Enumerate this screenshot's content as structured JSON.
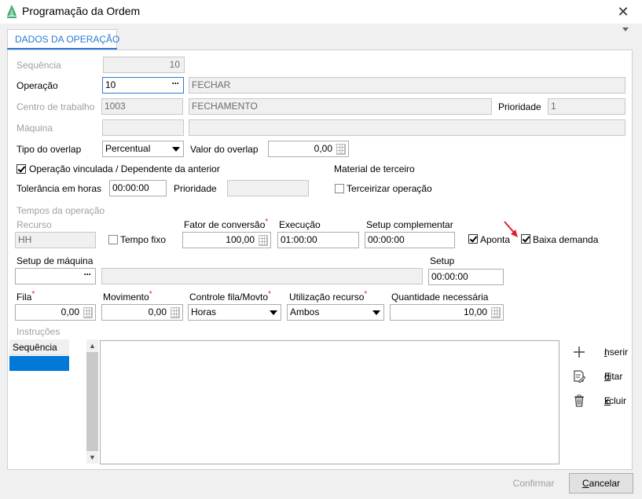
{
  "window": {
    "title": "Programação da Ordem",
    "close_glyph": "✕"
  },
  "tabs": [
    {
      "label": "DADOS DA OPERAÇÃO"
    }
  ],
  "form": {
    "sequencia": {
      "label": "Sequência",
      "value": "10"
    },
    "operacao": {
      "label": "Operação",
      "value": "10",
      "desc": "FECHAR",
      "lookup_glyph": "···"
    },
    "centro": {
      "label": "Centro de trabalho",
      "code": "1003",
      "desc": "FECHAMENTO"
    },
    "prioridade_top": {
      "label": "Prioridade",
      "value": "1"
    },
    "maquina": {
      "label": "Máquina",
      "code": "",
      "desc": ""
    },
    "tipo_overlap": {
      "label": "Tipo do overlap",
      "value": "Percentual"
    },
    "valor_overlap": {
      "label": "Valor do overlap",
      "value": "0,00"
    },
    "operacao_vinculada": {
      "label": "Operação vinculada / Dependente da anterior",
      "checked": true
    },
    "material_terceiro": {
      "label": "Material de terceiro"
    },
    "tolerancia": {
      "label": "Tolerância em horas",
      "value": "00:00:00"
    },
    "prioridade_mid": {
      "label": "Prioridade",
      "value": ""
    },
    "terceirizar": {
      "label": "Terceirizar operação",
      "checked": false
    }
  },
  "tempos": {
    "section_label": "Tempos da operação",
    "recurso": {
      "label": "Recurso",
      "value": "HH"
    },
    "tempo_fixo": {
      "label": "Tempo fixo",
      "checked": false
    },
    "fator_conversao": {
      "label": "Fator de conversão",
      "value": "100,00",
      "required_mark": "*"
    },
    "execucao": {
      "label": "Execução",
      "value": "01:00:00"
    },
    "setup_complementar": {
      "label": "Setup complementar",
      "value": "00:00:00"
    },
    "aponta": {
      "label": "Aponta",
      "checked": true
    },
    "baixa_demanda": {
      "label": "Baixa demanda",
      "checked": true
    },
    "setup_maquina": {
      "label": "Setup de máquina",
      "code": "",
      "desc": "",
      "lookup_glyph": "···"
    },
    "setup": {
      "label": "Setup",
      "value": "00:00:00"
    },
    "fila": {
      "label": "Fila",
      "value": "0,00",
      "required_mark": "*"
    },
    "movimento": {
      "label": "Movimento",
      "value": "0,00",
      "required_mark": "*"
    },
    "controle_fila": {
      "label": "Controle fila/Movto",
      "value": "Horas",
      "required_mark": "*"
    },
    "utilizacao_recurso": {
      "label": "Utilização recurso",
      "value": "Ambos",
      "required_mark": "*"
    },
    "quantidade_necessaria": {
      "label": "Quantidade necessária",
      "value": "10,00"
    }
  },
  "instrucoes": {
    "section_label": "Instruções",
    "list_header": "Sequência",
    "scroll_up": "▲",
    "scroll_down": "▼",
    "buttons": {
      "inserir": {
        "accel": "I",
        "rest": "nserir"
      },
      "editar": {
        "accel": "E",
        "rest": "ditar"
      },
      "excluir": {
        "accel": "E",
        "rest": "xcluir"
      }
    }
  },
  "footer": {
    "confirm_label": "Confirmar",
    "cancel_accel": "C",
    "cancel_rest": "ancelar"
  },
  "colors": {
    "accent": "#2a7bd2",
    "selection": "#0078d7",
    "required": "#e0202a",
    "annotation_arrow": "#e0202a"
  }
}
